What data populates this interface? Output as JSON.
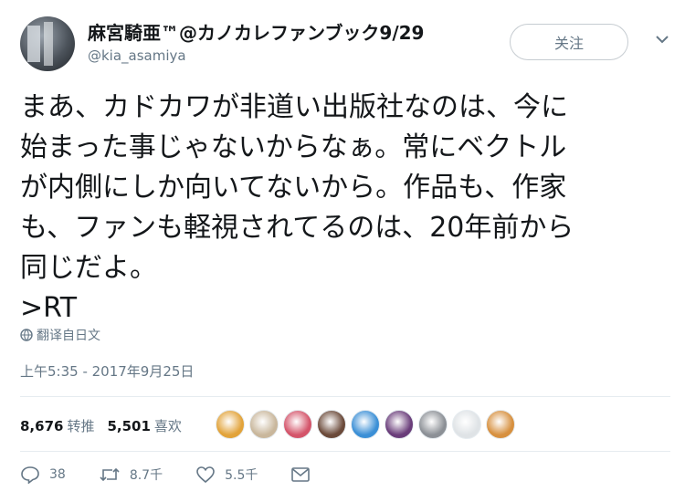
{
  "tweet": {
    "display_name": "麻宮騎亜™@カノカレファンブック9/29",
    "handle": "@kia_asamiya",
    "follow_label": "关注",
    "text": "まあ、カドカワが非道い出版社なのは、今に\n始まった事じゃないからなぁ。常にベクトル\nが内側にしか向いてないから。作品も、作家\nも、ファンも軽視されてるのは、20年前から\n同じだよ。\n>RT",
    "translate_label": "翻译自日文",
    "timestamp": "上午5:35 - 2017年9月25日"
  },
  "stats": {
    "retweets_count": "8,676",
    "retweets_label": "转推",
    "likes_count": "5,501",
    "likes_label": "喜欢"
  },
  "liker_avatars": [
    {
      "name": "avatar-1",
      "color": "#e2a33a"
    },
    {
      "name": "avatar-2",
      "color": "#c9b79c"
    },
    {
      "name": "avatar-3",
      "color": "#d4546a"
    },
    {
      "name": "avatar-4",
      "color": "#6b4a3a"
    },
    {
      "name": "avatar-5",
      "color": "#3b8fd6"
    },
    {
      "name": "avatar-6",
      "color": "#6a3d7a"
    },
    {
      "name": "avatar-7",
      "color": "#8c9096"
    },
    {
      "name": "avatar-8",
      "color": "#dfe3e6"
    },
    {
      "name": "avatar-9",
      "color": "#d7903f"
    }
  ],
  "actions": {
    "reply_count": "38",
    "retweet_count": "8.7千",
    "like_count": "5.5千"
  },
  "icons": {
    "reply": "reply-icon",
    "retweet": "retweet-icon",
    "like": "heart-icon",
    "dm": "envelope-icon",
    "translate": "globe-icon",
    "menu": "chevron-down-icon"
  }
}
